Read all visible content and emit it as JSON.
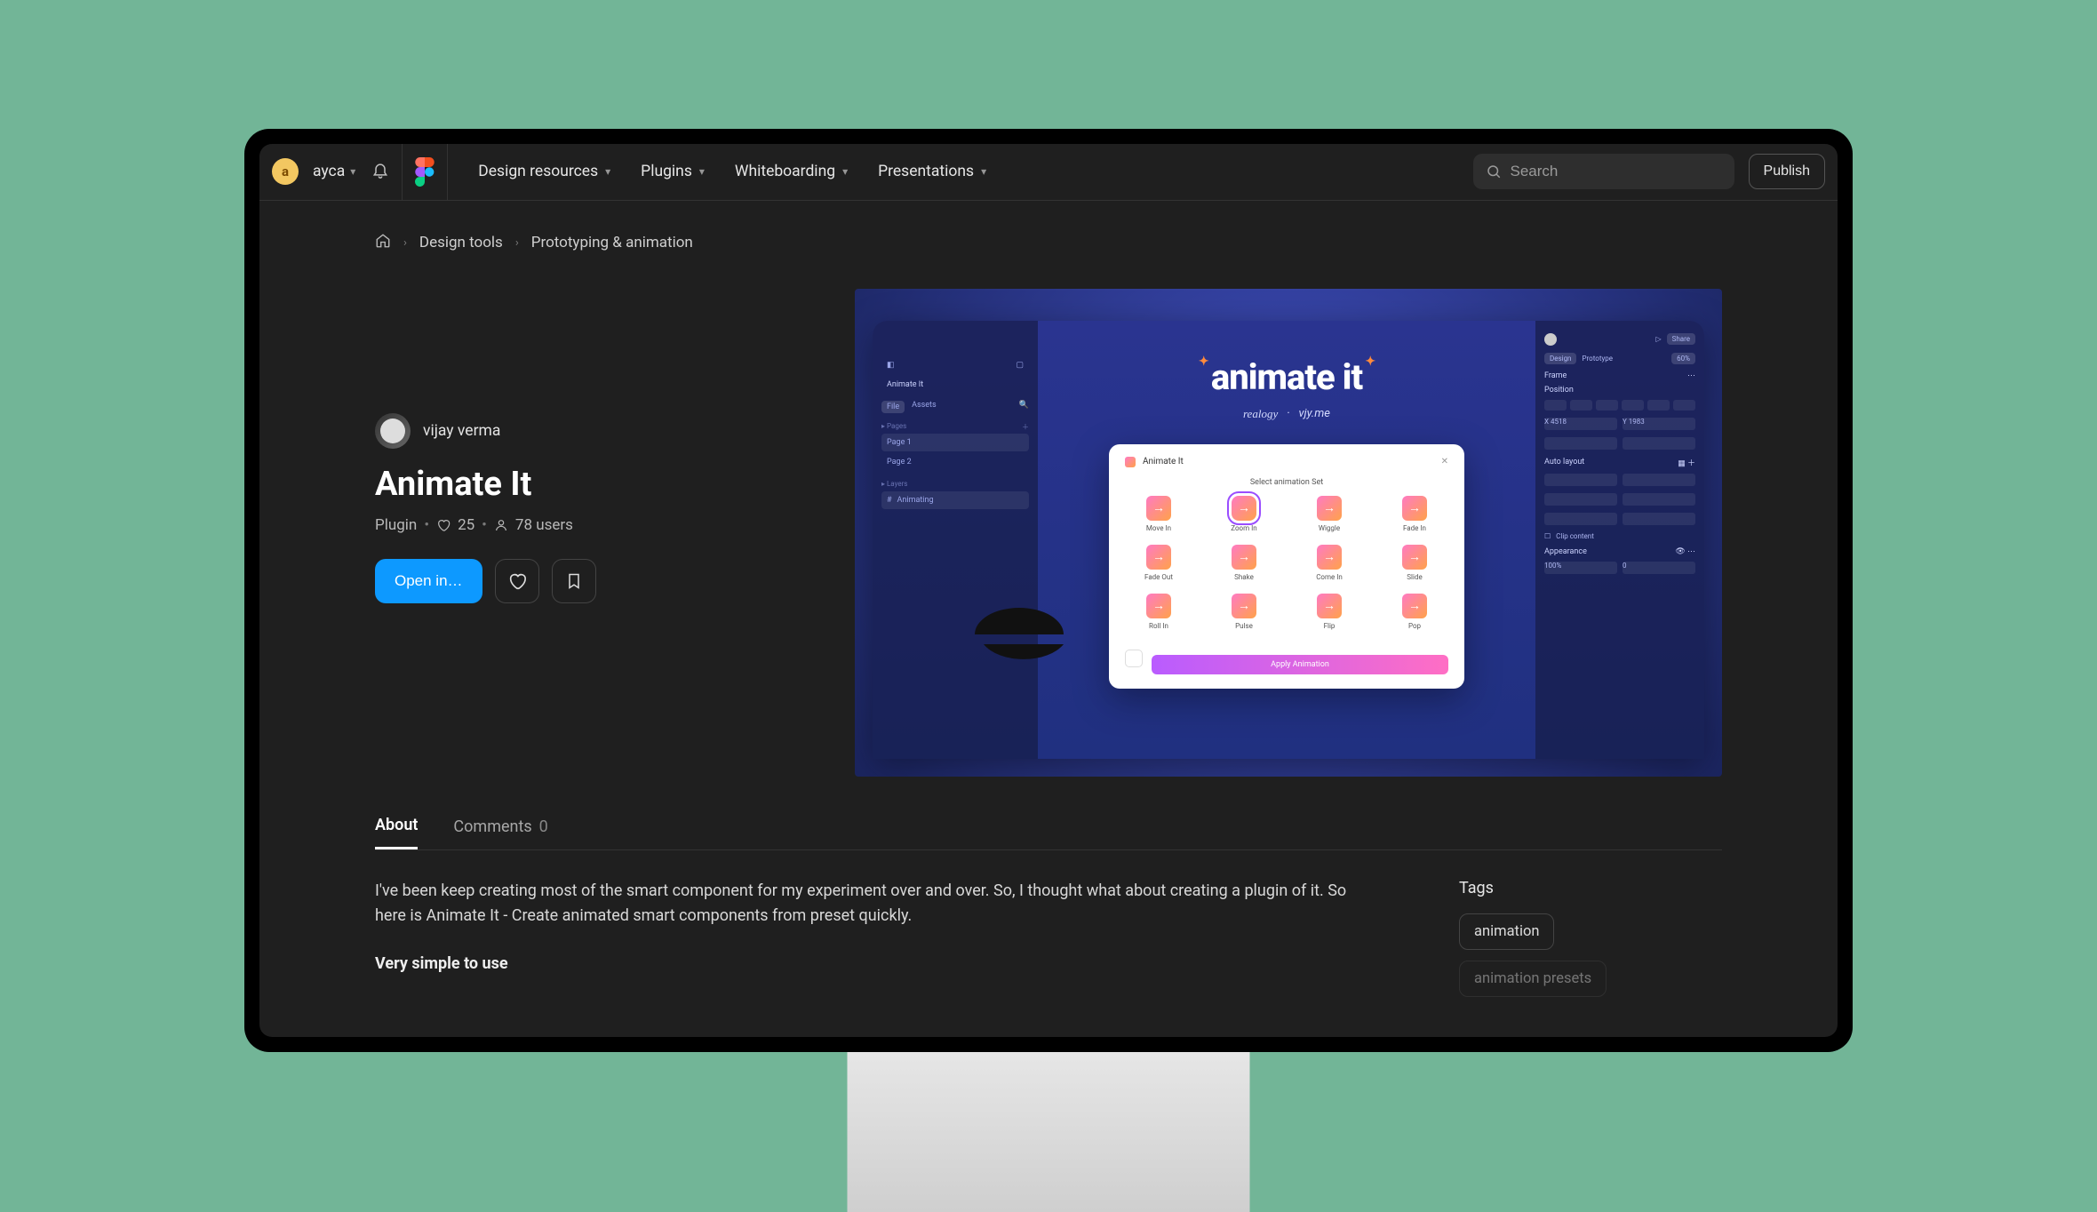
{
  "nav": {
    "userInitial": "a",
    "userName": "ayca",
    "links": {
      "design": "Design resources",
      "plugins": "Plugins",
      "whiteboarding": "Whiteboarding",
      "presentations": "Presentations"
    },
    "searchPlaceholder": "Search",
    "publish": "Publish"
  },
  "breadcrumbs": {
    "item1": "Design tools",
    "item2": "Prototyping & animation"
  },
  "page": {
    "author": "vijay verma",
    "title": "Animate It",
    "typeLabel": "Plugin",
    "likes": "25",
    "users": "78 users",
    "openButton": "Open in…"
  },
  "hero": {
    "tabTitle": "Animate It",
    "fileLabel": "Animate It",
    "sideFile": "File",
    "sideAssets": "Assets",
    "pagesLabel": "Pages",
    "page1": "Page 1",
    "page2": "Page 2",
    "layersLabel": "Layers",
    "layer1": "Animating",
    "animateTitle": "animate it",
    "subLeft": "realogy",
    "subRight": "vjy.me",
    "panelTitle": "Animate It",
    "panelSub": "Select animation Set",
    "cells": [
      "Move In",
      "Zoom In",
      "Wiggle",
      "Fade In",
      "Fade Out",
      "Shake",
      "Come In",
      "Slide",
      "Roll In",
      "Pulse",
      "Flip",
      "Pop"
    ],
    "applyLabel": "Apply Animation",
    "shareLabel": "Share",
    "designLabel": "Design",
    "protoLabel": "Prototype",
    "zoomLabel": "60%",
    "frameLabel": "Frame",
    "positionLabel": "Position",
    "xLabel": "X  4518",
    "yLabel": "Y  1983",
    "autoLayout": "Auto layout",
    "clipLabel": "Clip content",
    "appearance": "Appearance",
    "opacity": "100%",
    "radius": "0"
  },
  "tabs": {
    "about": "About",
    "comments": "Comments",
    "commentsCount": "0"
  },
  "about": {
    "p1": "I've been keep creating most of the smart component for my experiment over and over. So, I thought what about creating a plugin of it. So here is Animate It - Create animated smart components from preset quickly.",
    "h1": "Very simple to use"
  },
  "tags": {
    "title": "Tags",
    "items": [
      "animation",
      "animation presets"
    ]
  }
}
